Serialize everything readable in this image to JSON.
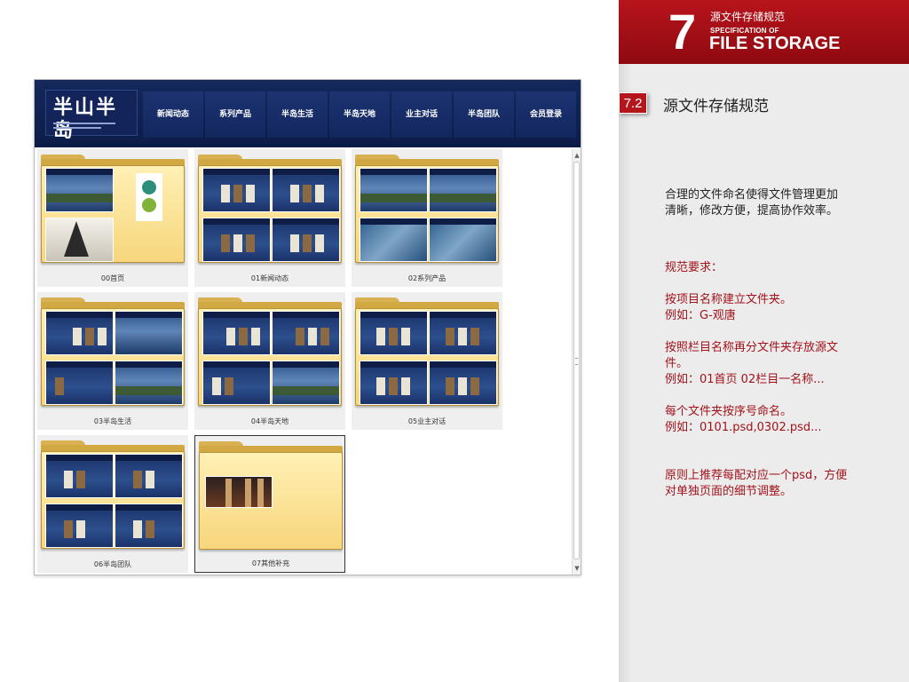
{
  "site": {
    "logo_text": "半山半岛",
    "nav": [
      "新闻动态",
      "系列产品",
      "半岛生活",
      "半岛天地",
      "业主对话",
      "半岛团队",
      "会员登录"
    ]
  },
  "folders": [
    {
      "label": "00首页",
      "preview": "home"
    },
    {
      "label": "01新闻动态",
      "preview": "news"
    },
    {
      "label": "02系列产品",
      "preview": "products"
    },
    {
      "label": "03半岛生活",
      "preview": "life"
    },
    {
      "label": "04半岛天地",
      "preview": "world"
    },
    {
      "label": "05业主对话",
      "preview": "dialogue"
    },
    {
      "label": "06半岛团队",
      "preview": "team"
    },
    {
      "label": "07其他补充",
      "preview": "other",
      "selected": true
    }
  ],
  "chapter": {
    "number": "7",
    "title_cn": "源文件存储规范",
    "title_en_small": "SPECIFICATION OF",
    "title_en_big": "FILE STORAGE"
  },
  "section": {
    "number": "7.2",
    "title": "源文件存储规范"
  },
  "body": {
    "intro": [
      "合理的文件命名使得文件管理更加",
      "清晰，修改方便，提高协作效率。"
    ],
    "req_title": "规范要求：",
    "rule1": [
      "按项目名称建立文件夹。",
      "例如：G-观唐"
    ],
    "rule2": [
      "按照栏目名称再分文件夹存放源文",
      "件。",
      "例如：01首页 02栏目一名称..."
    ],
    "rule3": [
      "每个文件夹按序号命名。",
      "例如：0101.psd,0302.psd..."
    ],
    "note": [
      "原则上推荐每配对应一个psd，方便",
      "对单独页面的细节调整。"
    ]
  },
  "colors": {
    "brand_red": "#a2121a",
    "header_navy": "#14285c",
    "folder_yellow": "#f7d67c"
  }
}
